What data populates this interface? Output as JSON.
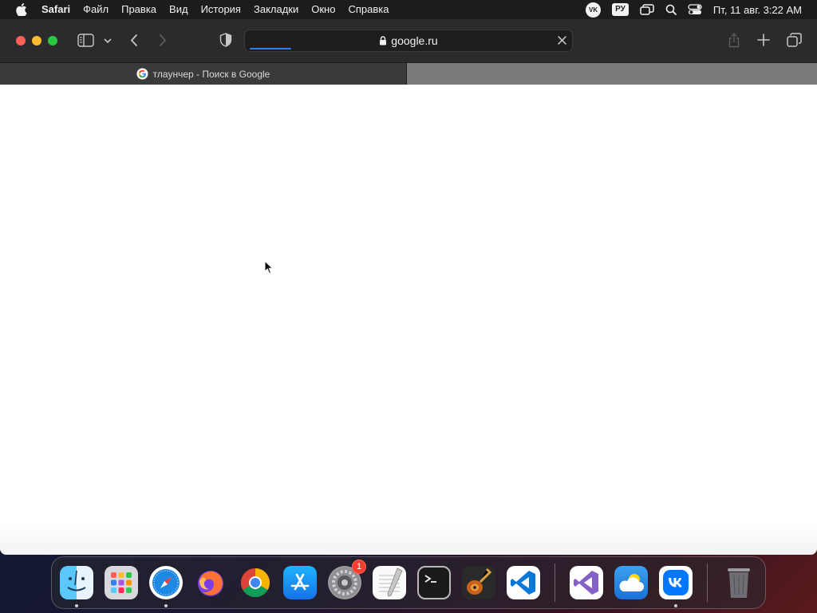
{
  "menubar": {
    "app_name": "Safari",
    "items": [
      "Файл",
      "Правка",
      "Вид",
      "История",
      "Закладки",
      "Окно",
      "Справка"
    ],
    "status": {
      "vk_label": "VK",
      "language": "РУ",
      "clock": "Пт, 11 авг.  3:22 AM"
    }
  },
  "browser": {
    "address_text": "google.ru",
    "load_progress": 0.13,
    "tabs": [
      {
        "title": "тлаунчер - Поиск в Google",
        "active": true
      }
    ]
  },
  "dock": {
    "apps": [
      {
        "name": "Finder",
        "icon": "finder-icon",
        "running": true
      },
      {
        "name": "Launchpad",
        "icon": "launchpad-icon",
        "running": false
      },
      {
        "name": "Safari",
        "icon": "safari-icon",
        "running": true
      },
      {
        "name": "Firefox",
        "icon": "firefox-icon",
        "running": false
      },
      {
        "name": "Google Chrome",
        "icon": "chrome-icon",
        "running": false
      },
      {
        "name": "App Store",
        "icon": "app-store-icon",
        "running": false
      },
      {
        "name": "System Settings",
        "icon": "settings-icon",
        "running": false,
        "badge": "1"
      },
      {
        "name": "TextEdit",
        "icon": "textedit-icon",
        "running": false
      },
      {
        "name": "Terminal",
        "icon": "terminal-icon",
        "running": false
      },
      {
        "name": "GarageBand",
        "icon": "garageband-icon",
        "running": false
      },
      {
        "name": "Visual Studio Code",
        "icon": "vscode-icon",
        "running": false
      }
    ],
    "recent": [
      {
        "name": "Visual Studio",
        "icon": "visual-studio-icon",
        "running": false
      },
      {
        "name": "Weather",
        "icon": "weather-icon",
        "running": false
      },
      {
        "name": "VK",
        "icon": "vk-icon",
        "running": true
      }
    ],
    "trash": {
      "name": "Trash",
      "icon": "trash-icon"
    }
  },
  "colors": {
    "traffic_close": "#ff5f57",
    "traffic_minimize": "#febc2e",
    "traffic_zoom": "#28c840",
    "progress": "#2f80ed",
    "badge": "#ff3b30"
  }
}
